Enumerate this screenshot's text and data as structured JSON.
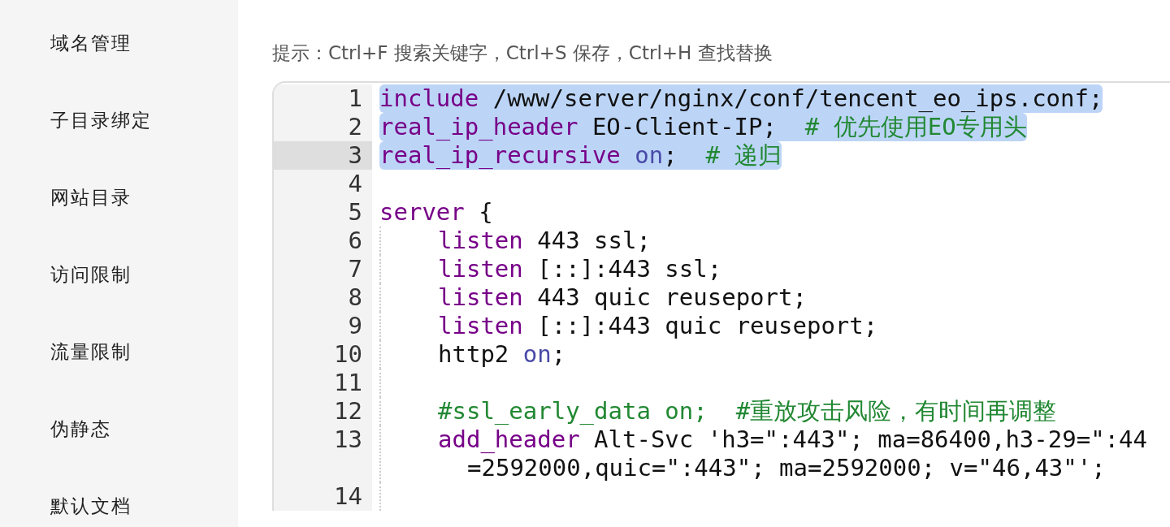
{
  "sidebar": {
    "items": [
      {
        "label": "域名管理",
        "selected": false
      },
      {
        "label": "子目录绑定",
        "selected": false
      },
      {
        "label": "网站目录",
        "selected": false
      },
      {
        "label": "访问限制",
        "selected": false
      },
      {
        "label": "流量限制",
        "selected": false
      },
      {
        "label": "伪静态",
        "selected": false
      },
      {
        "label": "默认文档",
        "selected": false
      }
    ]
  },
  "hint": "提示：Ctrl+F 搜索关键字，Ctrl+S 保存，Ctrl+H 查找替换",
  "editor": {
    "lines": [
      {
        "number": "1",
        "selected": true,
        "active": false,
        "tokens": [
          {
            "kind": "keyword",
            "text": "include"
          },
          {
            "kind": "plain",
            "text": " /www/server/nginx/conf/tencent_eo_ips.conf;"
          }
        ]
      },
      {
        "number": "2",
        "selected": true,
        "active": false,
        "tokens": [
          {
            "kind": "keyword",
            "text": "real_ip_header"
          },
          {
            "kind": "plain",
            "text": " EO-Client-IP;  "
          },
          {
            "kind": "comment",
            "text": "# 优先使用EO专用头"
          }
        ]
      },
      {
        "number": "3",
        "selected": true,
        "active": true,
        "tokens": [
          {
            "kind": "keyword",
            "text": "real_ip_recursive "
          },
          {
            "kind": "atom",
            "text": "on"
          },
          {
            "kind": "plain",
            "text": ";  "
          },
          {
            "kind": "comment",
            "text": "# 递归"
          }
        ]
      },
      {
        "number": "4",
        "selected": false,
        "active": false
      },
      {
        "number": "5",
        "selected": false,
        "active": false,
        "tokens": [
          {
            "kind": "keyword",
            "text": "server"
          },
          {
            "kind": "plain",
            "text": " {"
          }
        ],
        "children": [
          {
            "number": "6",
            "selected": false,
            "active": false,
            "tokens": [
              {
                "kind": "keyword",
                "text": "listen"
              },
              {
                "kind": "plain",
                "text": " 443 ssl;"
              }
            ]
          },
          {
            "number": "7",
            "selected": false,
            "active": false,
            "tokens": [
              {
                "kind": "keyword",
                "text": "listen"
              },
              {
                "kind": "plain",
                "text": " [::]:443 ssl;"
              }
            ]
          },
          {
            "number": "8",
            "selected": false,
            "active": false,
            "tokens": [
              {
                "kind": "keyword",
                "text": "listen"
              },
              {
                "kind": "plain",
                "text": " 443 quic reuseport;"
              }
            ]
          },
          {
            "number": "9",
            "selected": false,
            "active": false,
            "tokens": [
              {
                "kind": "keyword",
                "text": "listen"
              },
              {
                "kind": "plain",
                "text": " [::]:443 quic reuseport;"
              }
            ]
          },
          {
            "number": "10",
            "selected": false,
            "active": false,
            "tokens": [
              {
                "kind": "plain",
                "text": "http2 "
              },
              {
                "kind": "atom",
                "text": "on"
              },
              {
                "kind": "plain",
                "text": ";"
              }
            ]
          },
          {
            "number": "11",
            "selected": false,
            "active": false
          },
          {
            "number": "12",
            "selected": false,
            "active": false,
            "tokens": [
              {
                "kind": "comment",
                "text": "#ssl_early_data on;  #重放攻击风险，有时间再调整"
              }
            ]
          },
          {
            "number": "13",
            "selected": false,
            "active": false,
            "tokens": [
              {
                "kind": "keyword",
                "text": "add_header"
              },
              {
                "kind": "plain",
                "text": " Alt-Svc 'h3=\":443\"; ma=86400,h3-29=\":44"
              }
            ],
            "wrap": "=2592000,quic=\":443\"; ma=2592000; v=\"46,43\"';"
          },
          {
            "number": "14",
            "selected": false,
            "active": false
          }
        ]
      }
    ]
  }
}
